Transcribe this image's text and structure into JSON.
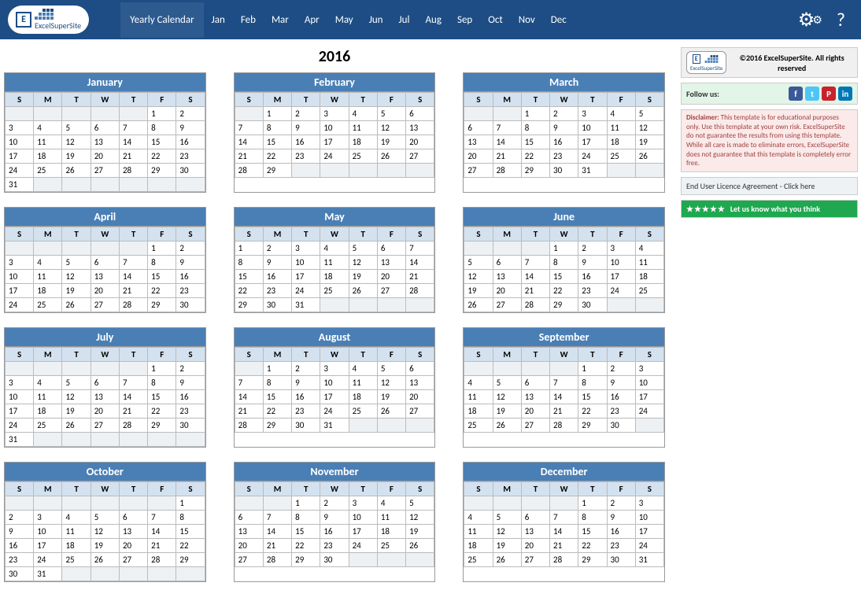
{
  "header": {
    "logo_text": "ExcelSuperSite",
    "nav_active": "Yearly Calendar",
    "nav_items": [
      "Jan",
      "Feb",
      "Mar",
      "Apr",
      "May",
      "Jun",
      "Jul",
      "Aug",
      "Sep",
      "Oct",
      "Nov",
      "Dec"
    ]
  },
  "year": "2016",
  "day_headers": [
    "S",
    "M",
    "T",
    "W",
    "T",
    "F",
    "S"
  ],
  "months": [
    {
      "name": "January",
      "start": 5,
      "days": 31
    },
    {
      "name": "February",
      "start": 1,
      "days": 29
    },
    {
      "name": "March",
      "start": 2,
      "days": 31
    },
    {
      "name": "April",
      "start": 5,
      "days": 30
    },
    {
      "name": "May",
      "start": 0,
      "days": 31
    },
    {
      "name": "June",
      "start": 3,
      "days": 30
    },
    {
      "name": "July",
      "start": 5,
      "days": 31
    },
    {
      "name": "August",
      "start": 1,
      "days": 31
    },
    {
      "name": "September",
      "start": 4,
      "days": 30
    },
    {
      "name": "October",
      "start": 6,
      "days": 31
    },
    {
      "name": "November",
      "start": 2,
      "days": 30
    },
    {
      "name": "December",
      "start": 4,
      "days": 31
    }
  ],
  "sidebar": {
    "copyright": "©2016 ExcelSuperSite. All rights reserved",
    "follow_label": "Follow us:",
    "disclaimer_label": "Disclaimer:",
    "disclaimer_text": "This template is for educational purposes only. Use this template at your own risk. ExcelSuperSite do not guarantee the results from using this template. While all care is made to eliminate errors, ExcelSuperSite does not guarantee that this template is completely error free.",
    "eula": "End User Licence Agreement - Click here",
    "review": "Let us know what you think"
  }
}
